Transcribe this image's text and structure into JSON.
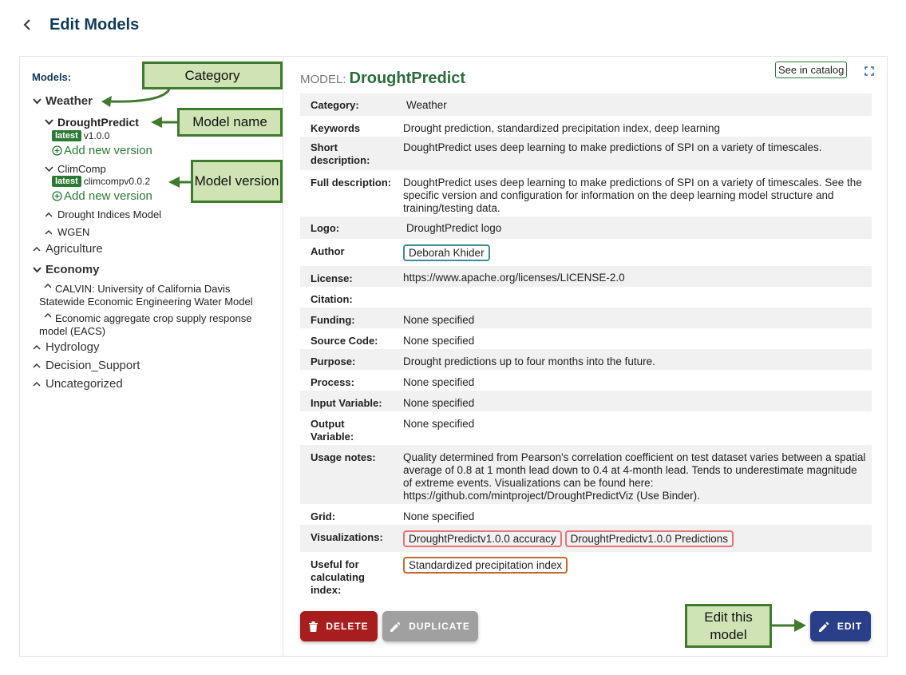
{
  "header": {
    "title": "Edit Models"
  },
  "sidebar": {
    "label": "Models:",
    "weather": {
      "label": "Weather",
      "drought": {
        "name": "DroughtPredict",
        "badge": "latest",
        "version": "v1.0.0",
        "add": "Add new version"
      },
      "climcomp": {
        "name": "ClimComp",
        "badge": "latest",
        "version": "climcompv0.0.2",
        "add": "Add new version"
      },
      "other_models": [
        "Drought Indices Model",
        "WGEN"
      ]
    },
    "agriculture": "Agriculture",
    "economy": {
      "label": "Economy",
      "models": [
        "CALVIN: University of California Davis Statewide Economic Engineering Water Model",
        "Economic aggregate crop supply response model (EACS)"
      ]
    },
    "hydrology": "Hydrology",
    "decision_support": "Decision_Support",
    "uncategorized": "Uncategorized"
  },
  "annotations": {
    "category": "Category",
    "model_name": "Model name",
    "model_version": "Model version",
    "edit_model": "Edit this model"
  },
  "detail": {
    "prefix": "MODEL:",
    "name": "DroughtPredict",
    "catalog_button": "See in catalog",
    "fields": {
      "category": {
        "label": "Category:",
        "value": "Weather"
      },
      "keywords": {
        "label": "Keywords",
        "value": "Drought prediction, standardized precipitation index, deep learning"
      },
      "short_description": {
        "label": "Short description:",
        "value": "DoughtPredict uses deep learning to make predictions of SPI on a variety of timescales."
      },
      "full_description": {
        "label": "Full description:",
        "value": "DoughtPredict uses deep learning to make predictions of SPI on a variety of timescales. See the specific version and configuration for information on the deep learning model structure and training/testing data."
      },
      "logo": {
        "label": "Logo:",
        "value": "DroughtPredict logo"
      },
      "author": {
        "label": "Author",
        "value": "Deborah Khider"
      },
      "license": {
        "label": "License:",
        "value": "https://www.apache.org/licenses/LICENSE-2.0"
      },
      "citation": {
        "label": "Citation:",
        "value": ""
      },
      "funding": {
        "label": "Funding:",
        "value": "None specified"
      },
      "source_code": {
        "label": "Source Code:",
        "value": "None specified"
      },
      "purpose": {
        "label": "Purpose:",
        "value": "Drought predictions up to four months into the future."
      },
      "process": {
        "label": "Process:",
        "value": "None specified"
      },
      "input_variable": {
        "label": "Input Variable:",
        "value": "None specified"
      },
      "output_variable": {
        "label": "Output Variable:",
        "value": "None specified"
      },
      "usage_notes": {
        "label": "Usage notes:",
        "value": "Quality determined from Pearson's correlation coefficient on test dataset varies between a spatial average of 0.8 at 1 month lead down to 0.4 at 4-month lead. Tends to underestimate magnitude of extreme events. Visualizations can be found here: https://github.com/mintproject/DroughtPredictViz (Use Binder)."
      },
      "grid": {
        "label": "Grid:",
        "value": "None specified"
      },
      "visualizations": {
        "label": "Visualizations:",
        "items": [
          "DroughtPredictv1.0.0 accuracy",
          "DroughtPredictv1.0.0 Predictions"
        ]
      },
      "useful_for": {
        "label": "Useful for calculating index:",
        "value": "Standardized precipitation index"
      }
    },
    "buttons": {
      "delete": "DELETE",
      "duplicate": "DUPLICATE",
      "edit": "EDIT"
    }
  },
  "colors": {
    "title": "#0e3a5b",
    "green": "#2a7a34",
    "delete": "#a81d1d",
    "edit": "#2a3f8a",
    "callout_fill": "#cfe3b5",
    "callout_border": "#3f7a2d"
  },
  "icons": [
    "back-icon",
    "chevron-down-icon",
    "chevron-up-icon",
    "plus-circle-icon",
    "fullscreen-icon",
    "trash-icon",
    "pencil-icon",
    "arrow-icon"
  ]
}
